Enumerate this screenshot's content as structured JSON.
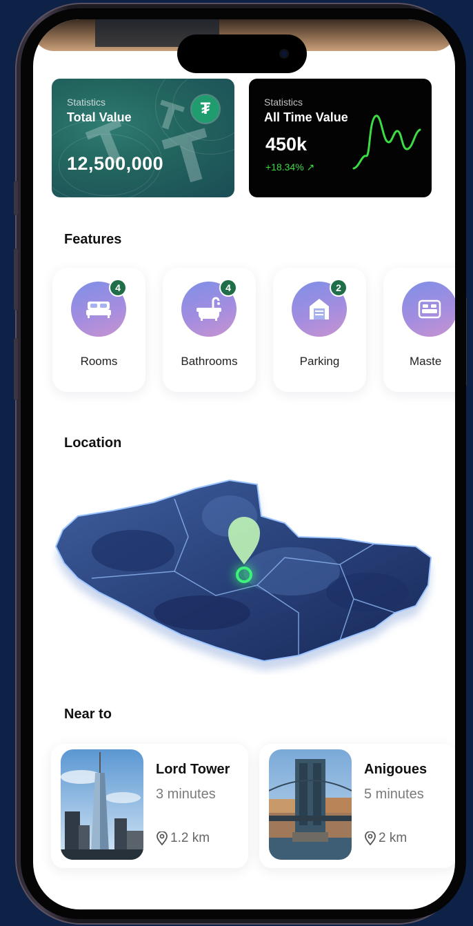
{
  "stats": {
    "total": {
      "kicker": "Statistics",
      "title": "Total Value",
      "value": "12,500,000",
      "icon": "tether-icon",
      "color": "#23665f"
    },
    "all_time": {
      "kicker": "Statistics",
      "title": "All Time Value",
      "value": "450k",
      "change": "+18.34% ↗",
      "trend_color": "#3ddc45"
    }
  },
  "features": {
    "title": "Features",
    "items": [
      {
        "label": "Rooms",
        "count": "4",
        "icon": "bed-icon"
      },
      {
        "label": "Bathrooms",
        "count": "4",
        "icon": "bathtub-icon"
      },
      {
        "label": "Parking",
        "count": "2",
        "icon": "garage-icon"
      },
      {
        "label": "Maste",
        "count": "",
        "icon": "master-bed-icon"
      }
    ]
  },
  "location": {
    "title": "Location",
    "marker_color": "#3cf27a"
  },
  "near_to": {
    "title": "Near to",
    "items": [
      {
        "name": "Lord Tower",
        "time": "3 minutes",
        "distance": "1.2 km",
        "icon": "location-pin-icon"
      },
      {
        "name": "Anigoues",
        "time": "5 minutes",
        "distance": "2 km",
        "icon": "location-pin-icon"
      }
    ]
  }
}
